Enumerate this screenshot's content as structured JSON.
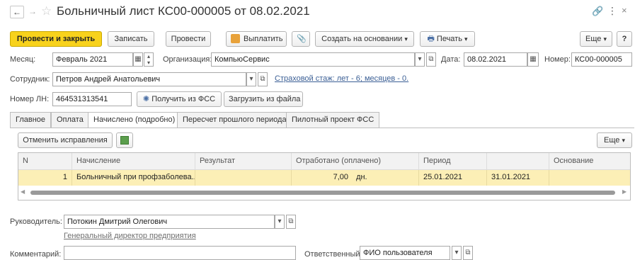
{
  "window": {
    "title": "Больничный лист КС00-000005 от 08.02.2021"
  },
  "toolbar": {
    "post_close": "Провести и закрыть",
    "write": "Записать",
    "post": "Провести",
    "pay": "Выплатить",
    "create_based": "Создать на основании",
    "print": "Печать",
    "more": "Еще",
    "help": "?"
  },
  "form": {
    "month_label": "Месяц:",
    "month_value": "Февраль 2021",
    "org_label": "Организация:",
    "org_value": "КомпьюСервис",
    "date_label": "Дата:",
    "date_value": "08.02.2021",
    "number_label": "Номер:",
    "number_value": "КС00-000005",
    "employee_label": "Сотрудник:",
    "employee_value": "Петров Андрей Анатольевич",
    "insurance_link": "Страховой стаж: лет - 6; месяцев - 0.",
    "ln_label": "Номер ЛН:",
    "ln_value": "464531313541",
    "get_fss": "Получить из ФСС",
    "load_file": "Загрузить из файла"
  },
  "tabs": [
    "Главное",
    "Оплата",
    "Начислено (подробно)",
    "Пересчет прошлого периода",
    "Пилотный проект ФСС"
  ],
  "subtoolbar": {
    "cancel_fix": "Отменить исправления",
    "more": "Еще"
  },
  "table": {
    "headers": [
      "N",
      "Начисление",
      "Результат",
      "Отработано (оплачено)",
      "Период",
      "",
      "Основание"
    ],
    "rows": [
      {
        "n": "1",
        "accrual": "Больничный при профзаболева...",
        "result": "",
        "worked": "7,00",
        "unit": "дн.",
        "period_from": "25.01.2021",
        "period_to": "31.01.2021",
        "basis": ""
      }
    ]
  },
  "footer": {
    "manager_label": "Руководитель:",
    "manager_value": "Потокин Дмитрий Олегович",
    "manager_position": "Генеральный директор предприятия",
    "comment_label": "Комментарий:",
    "comment_value": "",
    "responsible_label": "Ответственный:",
    "responsible_value": "ФИО пользователя"
  },
  "colors": {
    "accent_yellow": "#f8d21c",
    "row_highlight": "#fcefb6",
    "link_blue": "#3b5f95"
  }
}
